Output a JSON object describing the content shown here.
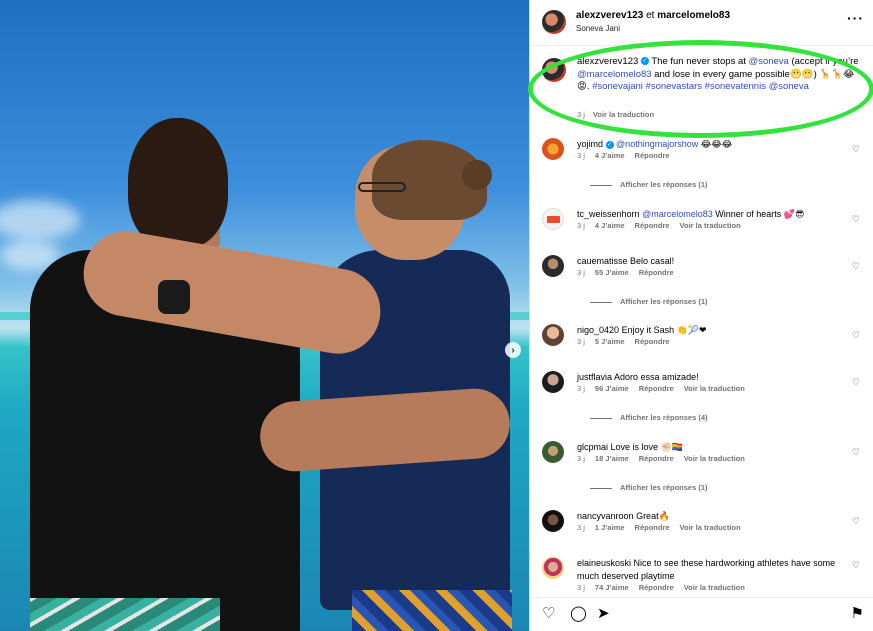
{
  "header": {
    "user1": "alexzverev123",
    "joiner": "et",
    "user2": "marcelomelo83",
    "location": "Soneva Jani",
    "more_icon": "more-horizontal-icon"
  },
  "caption": {
    "username": "alexzverev123",
    "verified": true,
    "text_a": "The fun never stops at ",
    "mention1": "@soneva",
    "text_b": " (accept if you’re ",
    "mention2": "@marcelomelo83",
    "text_c": " and lose in every game possible😬😬) 🦒🦒😂😡. ",
    "hashtags": "#sonevajani #sonevastars #sonevatennis",
    "mention3": "@soneva",
    "time": "3 j",
    "translate": "Voir la traduction"
  },
  "comments": [
    {
      "username": "yojimd",
      "verified": true,
      "mention": "@nothingmajorshow",
      "text": " 😂😂😂",
      "time": "3 j",
      "likes": "4 J’aime",
      "reply": "Répondre",
      "translate": "",
      "replies": "Afficher les réponses (1)"
    },
    {
      "username": "tc_weissenhorn",
      "verified": false,
      "mention": "@marcelomelo83",
      "text": " Winner of hearts 💕😎",
      "time": "3 j",
      "likes": "4 J’aime",
      "reply": "Répondre",
      "translate": "Voir la traduction",
      "replies": ""
    },
    {
      "username": "cauematisse",
      "verified": false,
      "mention": "",
      "text": "Belo casal!",
      "time": "3 j",
      "likes": "55 J’aime",
      "reply": "Répondre",
      "translate": "",
      "replies": "Afficher les réponses (1)"
    },
    {
      "username": "nigo_0420",
      "verified": false,
      "mention": "",
      "text": "Enjoy it Sash 👏🎾❤",
      "time": "3 j",
      "likes": "5 J’aime",
      "reply": "Répondre",
      "translate": "",
      "replies": ""
    },
    {
      "username": "justflavia",
      "verified": false,
      "mention": "",
      "text": "Adoro essa amizade!",
      "time": "3 j",
      "likes": "96 J’aime",
      "reply": "Répondre",
      "translate": "Voir la traduction",
      "replies": "Afficher les réponses (4)"
    },
    {
      "username": "glcpmai",
      "verified": false,
      "mention": "",
      "text": "Love is love ✊🏻🏳️‍🌈",
      "time": "3 j",
      "likes": "18 J’aime",
      "reply": "Répondre",
      "translate": "Voir la traduction",
      "replies": "Afficher les réponses (1)"
    },
    {
      "username": "nancyvanroon",
      "verified": false,
      "mention": "",
      "text": "Great🔥",
      "time": "3 j",
      "likes": "1 J’aime",
      "reply": "Répondre",
      "translate": "Voir la traduction",
      "replies": ""
    },
    {
      "username": "elaineuskoski",
      "verified": false,
      "mention": "",
      "text": "Nice to see these hardworking athletes have some much deserved playtime",
      "time": "3 j",
      "likes": "74 J’aime",
      "reply": "Répondre",
      "translate": "Voir la traduction",
      "replies": ""
    }
  ],
  "footer": {
    "like_icon": "heart-icon",
    "comment_icon": "comment-icon",
    "share_icon": "share-icon",
    "save_icon": "bookmark-icon"
  },
  "colors": {
    "link": "#2d4fb4",
    "highlight": "#33e23a",
    "verified": "#0095f6"
  }
}
